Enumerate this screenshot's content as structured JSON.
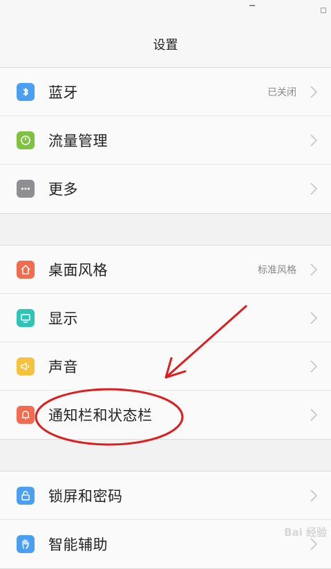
{
  "header": {
    "title": "设置"
  },
  "groups": [
    {
      "items": [
        {
          "label": "蓝牙",
          "value": "已关闭",
          "icon": "bluetooth-icon",
          "color": "#4a9ff2"
        },
        {
          "label": "流量管理",
          "value": "",
          "icon": "data-usage-icon",
          "color": "#7fc241"
        },
        {
          "label": "更多",
          "value": "",
          "icon": "more-icon",
          "color": "#8e8e93"
        }
      ]
    },
    {
      "items": [
        {
          "label": "桌面风格",
          "value": "标准风格",
          "icon": "home-icon",
          "color": "#f26b4f"
        },
        {
          "label": "显示",
          "value": "",
          "icon": "display-icon",
          "color": "#2ec4b6"
        },
        {
          "label": "声音",
          "value": "",
          "icon": "sound-icon",
          "color": "#f6c23e"
        },
        {
          "label": "通知栏和状态栏",
          "value": "",
          "icon": "notification-icon",
          "color": "#f26b4f"
        }
      ]
    },
    {
      "items": [
        {
          "label": "锁屏和密码",
          "value": "",
          "icon": "lock-icon",
          "color": "#4a9ff2"
        },
        {
          "label": "智能辅助",
          "value": "",
          "icon": "hand-icon",
          "color": "#4a9ff2"
        }
      ]
    }
  ],
  "annotation": {
    "color": "#e01b1b"
  },
  "watermark": "Bai 经验"
}
